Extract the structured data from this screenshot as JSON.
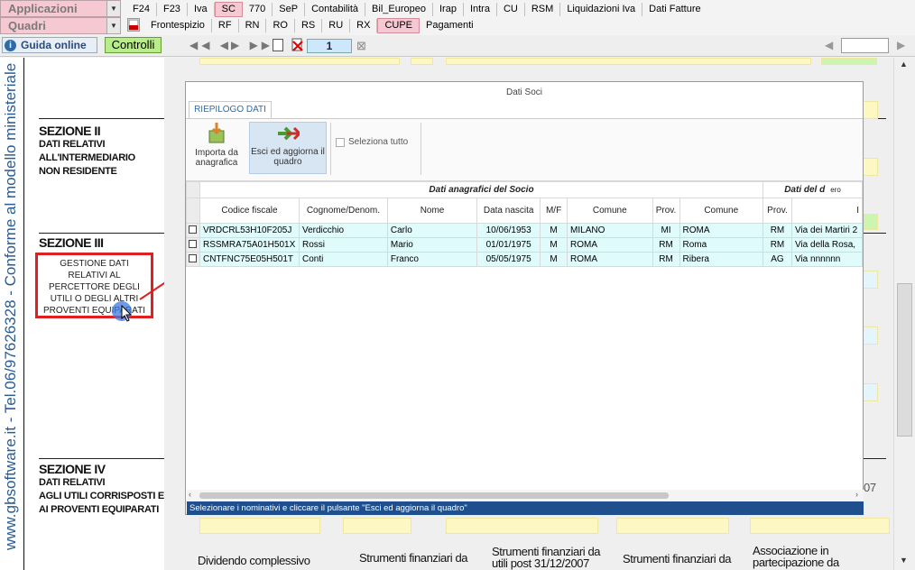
{
  "app_menu": {
    "applicazioni": "Applicazioni",
    "quadri": "Quadri"
  },
  "tabs_row1": [
    "F24",
    "F23",
    "Iva",
    "SC",
    "770",
    "SeP",
    "Contabilità",
    "Bil_Europeo",
    "Irap",
    "Intra",
    "CU",
    "RSM",
    "Liquidazioni Iva",
    "Dati Fatture"
  ],
  "tabs_row2": [
    "Frontespizio",
    "RF",
    "RN",
    "RO",
    "RS",
    "RU",
    "RX",
    "CUPE",
    "Pagamenti"
  ],
  "toolbar": {
    "guida": "Guida online",
    "controlli": "Controlli",
    "page": "1"
  },
  "sidebar_vertical": "www.gbsoftware.it - Tel.06/97626328 - Conforme al modello ministeriale",
  "sections": {
    "s2_title": "SEZIONE II",
    "s2_desc": [
      "DATI RELATIVI",
      "ALL'INTERMEDIARIO",
      "NON RESIDENTE"
    ],
    "s3_title": "SEZIONE III",
    "s4_title": "SEZIONE IV",
    "s4_desc": [
      "DATI RELATIVI",
      "AGLI UTILI CORRISPOSTI E",
      "AI PROVENTI EQUIPARATI"
    ]
  },
  "gestione_button": "GESTIONE DATI RELATIVI AL PERCETTORE DEGLI UTILI O DEGLI ALTRI PROVENTI EQUIPARATI",
  "bottom_labels": {
    "dividendo": "Dividendo complessivo",
    "strumenti1": "Strumenti finanziari da",
    "strumenti2": "Strumenti finanziari da utili post 31/12/2007",
    "strumenti3": "Strumenti finanziari da",
    "associazione": "Associazione in partecipazione da",
    "seven": "07"
  },
  "dialog": {
    "title": "Dati Soci",
    "tab": "RIEPILOGO DATI",
    "importa": "Importa da anagrafica",
    "esci": "Esci ed aggiorna il quadro",
    "seleziona": "Seleziona tutto",
    "group1": "Dati anagrafici del Socio",
    "group2": "Dati del d",
    "extra1": "ero",
    "extra2": "I",
    "columns": [
      "Codice fiscale",
      "Cognome/Denom.",
      "Nome",
      "Data nascita",
      "M/F",
      "Comune",
      "Prov.",
      "Comune",
      "Prov.",
      ""
    ],
    "rows": [
      [
        "VRDCRL53H10F205J",
        "Verdicchio",
        "Carlo",
        "10/06/1953",
        "M",
        "MILANO",
        "MI",
        "ROMA",
        "RM",
        "Via dei Martiri 2"
      ],
      [
        "RSSMRA75A01H501X",
        "Rossi",
        "Mario",
        "01/01/1975",
        "M",
        "ROMA",
        "RM",
        "Roma",
        "RM",
        "Via della Rosa,"
      ],
      [
        "CNTFNC75E05H501T",
        "Conti",
        "Franco",
        "05/05/1975",
        "M",
        "ROMA",
        "RM",
        "Ribera",
        "AG",
        "Via nnnnnn"
      ]
    ],
    "status": "Selezionare i nominativi e cliccare il pulsante \"Esci ed aggiorna il quadro\""
  },
  "colors": {
    "accent_pink": "#f5c8d2",
    "status_blue": "#1f4f8c",
    "row_cyan": "#e0fbfb",
    "highlight_red": "#e02020"
  }
}
